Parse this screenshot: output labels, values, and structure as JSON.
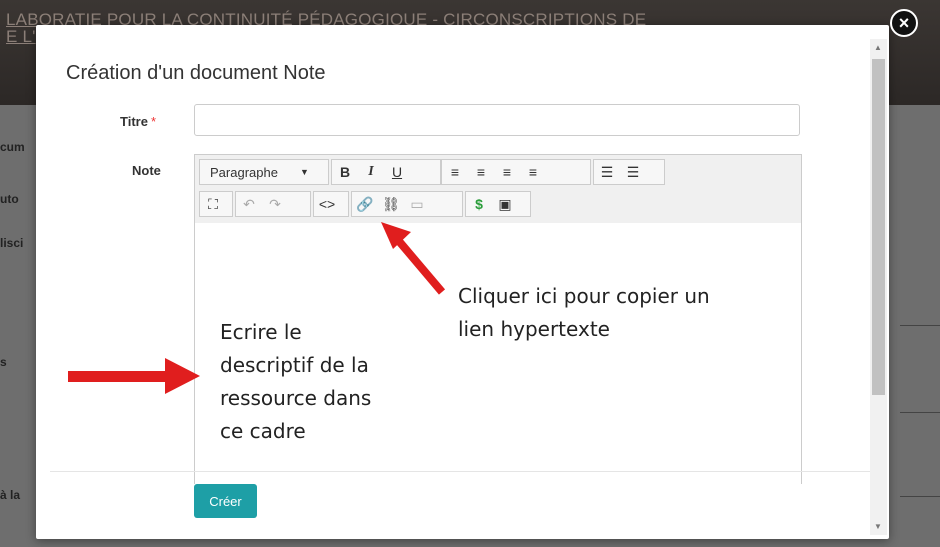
{
  "background": {
    "header_line1": "LABORATIE POUR LA CONTINUITÉ PÉDAGOGIQUE - CIRCONSCRIPTIONS DE",
    "header_line2": "E L'",
    "side_labels": [
      "cum",
      "uto",
      "lisci",
      "s",
      "à la"
    ]
  },
  "modal": {
    "title": "Création d'un document Note",
    "titre_label": "Titre",
    "required_mark": "*",
    "note_label": "Note",
    "toolbar": {
      "paragraph_select": "Paragraphe",
      "caret": "▼",
      "bold": "B",
      "italic": "I",
      "underline": "U",
      "align_left": "≡",
      "align_center": "≡",
      "align_right": "≡",
      "justify": "≡",
      "bullet_list": "☰",
      "numbered_list": "☰",
      "fullscreen": "⛶",
      "undo": "↶",
      "redo": "↷",
      "source_code": "<>",
      "link": "🔗",
      "unlink": "⛓",
      "embed": "▭",
      "special": "$",
      "image": "▣"
    },
    "create_button": "Créer",
    "close": "×"
  },
  "annotations": {
    "link_hint": [
      "Cliquer ici pour copier un",
      "lien hypertexte"
    ],
    "editor_hint": [
      "Ecrire le",
      "descriptif de la",
      "ressource dans",
      "ce cadre"
    ]
  },
  "colors": {
    "accent": "#1e9fa6",
    "arrow": "#e01e1e",
    "required": "#ee3333"
  }
}
